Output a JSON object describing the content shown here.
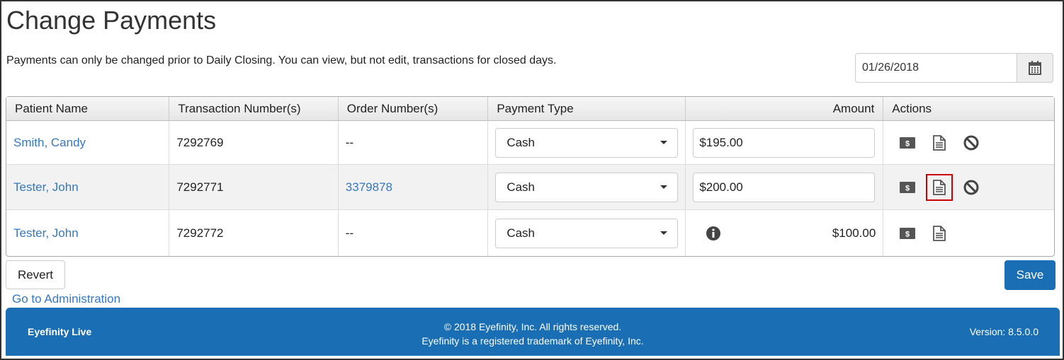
{
  "page": {
    "title": "Change Payments",
    "notice": "Payments can only be changed prior to Daily Closing. You can view, but not edit, transactions for closed days.",
    "date_value": "01/26/2018"
  },
  "table": {
    "headers": [
      "Patient Name",
      "Transaction Number(s)",
      "Order Number(s)",
      "Payment Type",
      "Amount",
      "Actions"
    ],
    "rows": [
      {
        "patient": "Smith, Candy",
        "transaction": "7292769",
        "order": "--",
        "payment_type": "Cash",
        "amount": "$195.00"
      },
      {
        "patient": "Tester, John",
        "transaction": "7292771",
        "order": "3379878",
        "payment_type": "Cash",
        "amount": "$200.00"
      },
      {
        "patient": "Tester, John",
        "transaction": "7292772",
        "order": "--",
        "payment_type": "Cash",
        "amount": "$100.00"
      }
    ]
  },
  "buttons": {
    "revert": "Revert",
    "save": "Save"
  },
  "links": {
    "admin": "Go to Administration"
  },
  "footer": {
    "brand": "Eyefinity Live",
    "copyright": "© 2018 Eyefinity, Inc. All rights reserved.",
    "trademark": "Eyefinity is a registered trademark of Eyefinity, Inc.",
    "version": "Version: 8.5.0.0"
  },
  "icons": {
    "calendar": "calendar-icon",
    "payment": "dollar-bill-icon",
    "receipt": "document-icon",
    "void": "ban-icon",
    "info": "info-circle-icon"
  },
  "colors": {
    "accent": "#1a6eb3",
    "link": "#3478c0",
    "highlight": "#cc0000"
  }
}
